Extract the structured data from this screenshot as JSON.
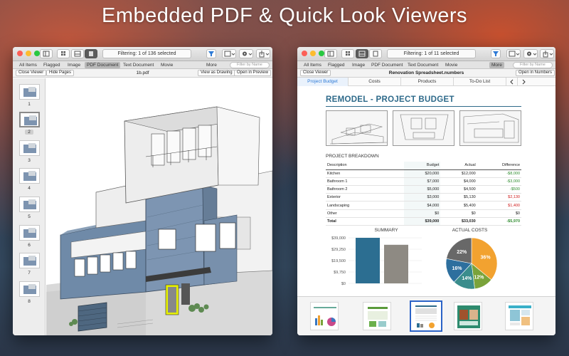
{
  "hero": {
    "title": "Embedded PDF & Quick Look Viewers"
  },
  "left": {
    "filter": "Filtering: 1 of 136 selected",
    "tabs": [
      "All Items",
      "Flagged",
      "Image",
      "PDF Document",
      "Text Document",
      "Movie"
    ],
    "selected_tab": "PDF Document",
    "more": "More",
    "search_placeholder": "Filter by Name",
    "close_viewer": "Close Viewer",
    "hide_pages": "Hide Pages",
    "doc_title": "1b.pdf",
    "view_as_drawing": "View as Drawing",
    "open_in_preview": "Open in Preview",
    "pages": [
      "1",
      "2",
      "3",
      "4",
      "5",
      "6",
      "7",
      "8"
    ],
    "selected_page": "2"
  },
  "right": {
    "filter": "Filtering: 1 of 11 selected",
    "tabs": [
      "All Items",
      "Flagged",
      "Image",
      "PDF Document",
      "Text Document",
      "Movie"
    ],
    "more": "More",
    "search_placeholder": "Filter by Name",
    "close_viewer": "Close Viewer",
    "doc_title": "Renovation Spreadsheet.numbers",
    "open_in_numbers": "Open in Numbers",
    "sheets": [
      "Project Budget",
      "Costs",
      "Products",
      "To-Do List"
    ],
    "selected_sheet": "Project Budget",
    "remodel_title": "REMODEL - PROJECT BUDGET",
    "breakdown_title": "PROJECT BREAKDOWN",
    "table": {
      "headers": [
        "Description",
        "Budget",
        "Actual",
        "Difference"
      ],
      "rows": [
        [
          "Kitchen",
          "$20,000",
          "$12,000",
          "-$8,000"
        ],
        [
          "Bathroom 1",
          "$7,000",
          "$4,000",
          "-$3,000"
        ],
        [
          "Bathroom 2",
          "$5,000",
          "$4,500",
          "-$500"
        ],
        [
          "Exterior",
          "$3,000",
          "$5,130",
          "$2,130"
        ],
        [
          "Landscaping",
          "$4,000",
          "$5,400",
          "$1,400"
        ],
        [
          "Other",
          "$0",
          "$0",
          "$0"
        ]
      ],
      "total": [
        "Total",
        "$39,000",
        "$33,030",
        "-$5,970"
      ]
    },
    "summary_title": "SUMMARY",
    "summary_ticks": [
      "$39,000",
      "$29,250",
      "$19,500",
      "$9,750",
      "$0"
    ],
    "actual_costs_title": "ACTUAL COSTS"
  },
  "chart_data": [
    {
      "type": "bar",
      "title": "SUMMARY",
      "categories": [
        "Budget",
        "Actual"
      ],
      "values": [
        39000,
        33030
      ],
      "ylim": [
        0,
        39000
      ],
      "ticks": [
        "$39,000",
        "$29,250",
        "$19,500",
        "$9,750",
        "$0"
      ],
      "colors": [
        "#2c6e91",
        "#8e8a83"
      ]
    },
    {
      "type": "pie",
      "title": "ACTUAL COSTS",
      "slices": [
        {
          "label": "36%",
          "value": 36,
          "color": "#f2a230"
        },
        {
          "label": "12%",
          "value": 12,
          "color": "#7aa33a"
        },
        {
          "label": "14%",
          "value": 14,
          "color": "#3a8d8c"
        },
        {
          "label": "16%",
          "value": 16,
          "color": "#2d6f9e"
        },
        {
          "label": "22%",
          "value": 22,
          "color": "#686868"
        }
      ]
    }
  ],
  "colors": {
    "accent_blue": "#2d7ad6",
    "title_teal": "#2e6a8a",
    "positive": "#2e8b2e",
    "negative": "#d02020"
  }
}
